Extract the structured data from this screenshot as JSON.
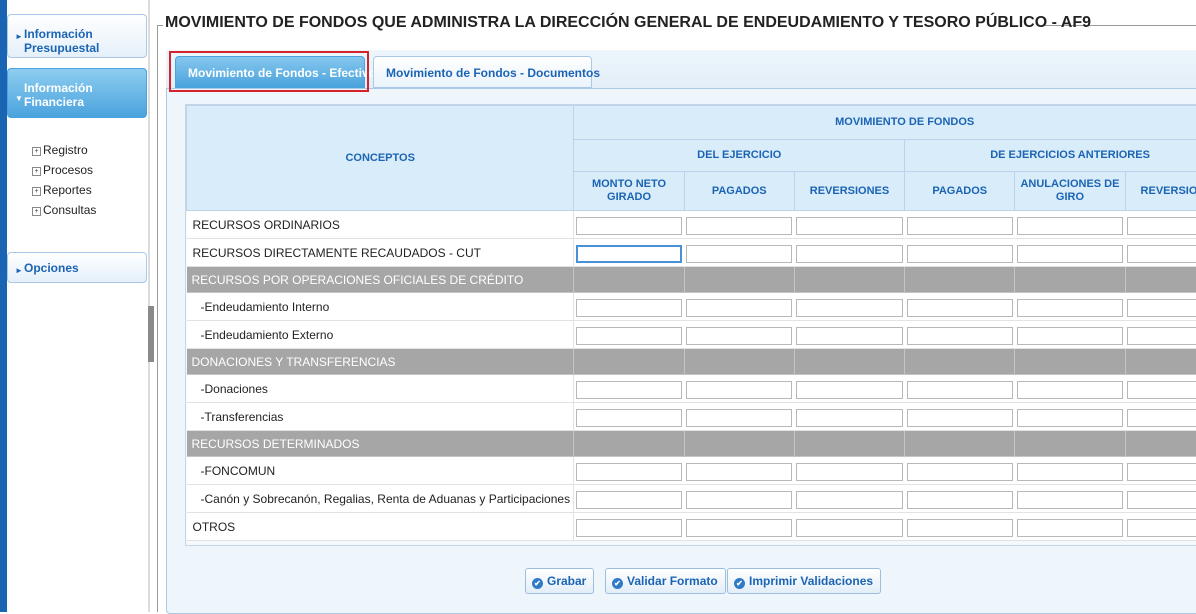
{
  "sidebar": {
    "sections": [
      {
        "label_line1": "Información",
        "label_line2": "Presupuestal",
        "arrow": "►"
      },
      {
        "label_line1": "Información",
        "label_line2": "Financiera",
        "arrow": "▼"
      },
      {
        "label": "Opciones",
        "arrow": "►"
      }
    ],
    "tree": [
      "Registro",
      "Procesos",
      "Reportes",
      "Consultas"
    ],
    "tree_expand_glyph": "+"
  },
  "page": {
    "title": "MOVIMIENTO DE FONDOS QUE ADMINISTRA LA DIRECCIÓN GENERAL DE ENDEUDAMIENTO Y TESORO PÚBLICO - AF9"
  },
  "tabs": [
    {
      "label": "Movimiento de Fondos - Efectivo",
      "active": true
    },
    {
      "label": "Movimiento de Fondos - Documentos",
      "active": false
    }
  ],
  "grid": {
    "header": {
      "conceptos": "CONCEPTOS",
      "movimiento": "MOVIMIENTO DE FONDOS",
      "del_ejercicio": "DEL EJERCICIO",
      "ejercicios_anteriores": "DE EJERCICIOS ANTERIORES",
      "columns": [
        "MONTO NETO GIRADO",
        "PAGADOS",
        "REVERSIONES",
        "PAGADOS",
        "ANULACIONES DE GIRO",
        "REVERSIONES"
      ]
    },
    "rows": [
      {
        "label": "RECURSOS ORDINARIOS",
        "type": "data"
      },
      {
        "label": "RECURSOS DIRECTAMENTE RECAUDADOS - CUT",
        "type": "data"
      },
      {
        "label": "RECURSOS POR OPERACIONES OFICIALES DE CRÉDITO",
        "type": "group"
      },
      {
        "label": "-Endeudamiento Interno",
        "type": "data"
      },
      {
        "label": "-Endeudamiento Externo",
        "type": "data"
      },
      {
        "label": "DONACIONES Y TRANSFERENCIAS",
        "type": "group"
      },
      {
        "label": "-Donaciones",
        "type": "data"
      },
      {
        "label": "-Transferencias",
        "type": "data"
      },
      {
        "label": "RECURSOS DETERMINADOS",
        "type": "group"
      },
      {
        "label": "-FONCOMUN",
        "type": "data"
      },
      {
        "label": "-Canón y Sobrecanón, Regalias, Renta de Aduanas y Participaciones",
        "type": "data"
      },
      {
        "label": "OTROS",
        "type": "data"
      }
    ]
  },
  "buttons": [
    {
      "label": "Grabar",
      "icon": "check-circle-icon"
    },
    {
      "label": "Validar Formato",
      "icon": "check-circle-icon"
    },
    {
      "label": "Imprimir Validaciones",
      "icon": "check-circle-icon"
    }
  ],
  "colors": {
    "accent": "#4aa3dd",
    "brand_blue": "#1b64b4",
    "group_row": "#a6a6a6",
    "highlight": "#d4232b"
  }
}
